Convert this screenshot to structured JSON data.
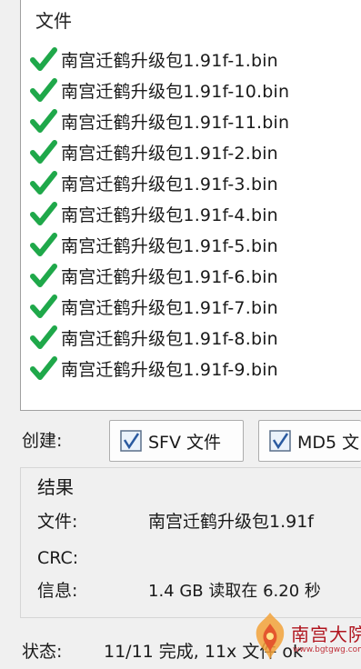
{
  "file_list": {
    "header": "文件",
    "items": [
      "南宫迁鹤升级包1.91f-1.bin",
      "南宫迁鹤升级包1.91f-10.bin",
      "南宫迁鹤升级包1.91f-11.bin",
      "南宫迁鹤升级包1.91f-2.bin",
      "南宫迁鹤升级包1.91f-3.bin",
      "南宫迁鹤升级包1.91f-4.bin",
      "南宫迁鹤升级包1.91f-5.bin",
      "南宫迁鹤升级包1.91f-6.bin",
      "南宫迁鹤升级包1.91f-7.bin",
      "南宫迁鹤升级包1.91f-8.bin",
      "南宫迁鹤升级包1.91f-9.bin"
    ],
    "status_icon": "green-check-icon"
  },
  "create": {
    "label": "创建:",
    "sfv_button": "SFV 文件",
    "md5_button": "MD5 文"
  },
  "result": {
    "title": "结果",
    "file_label": "文件:",
    "file_value": "南宫迁鹤升级包1.91f",
    "crc_label": "CRC:",
    "crc_value": "",
    "info_label": "信息:",
    "info_value": "1.4 GB 读取在 6.20 秒"
  },
  "status": {
    "label": "状态:",
    "value": "11/11 完成, 11x 文件 ok"
  },
  "watermark": {
    "text": "南宫大院",
    "url": "www.bgtgwg.com"
  },
  "colors": {
    "check_green": "#1fa84a",
    "background": "#f0f0f0",
    "watermark_red": "#b0141e"
  }
}
